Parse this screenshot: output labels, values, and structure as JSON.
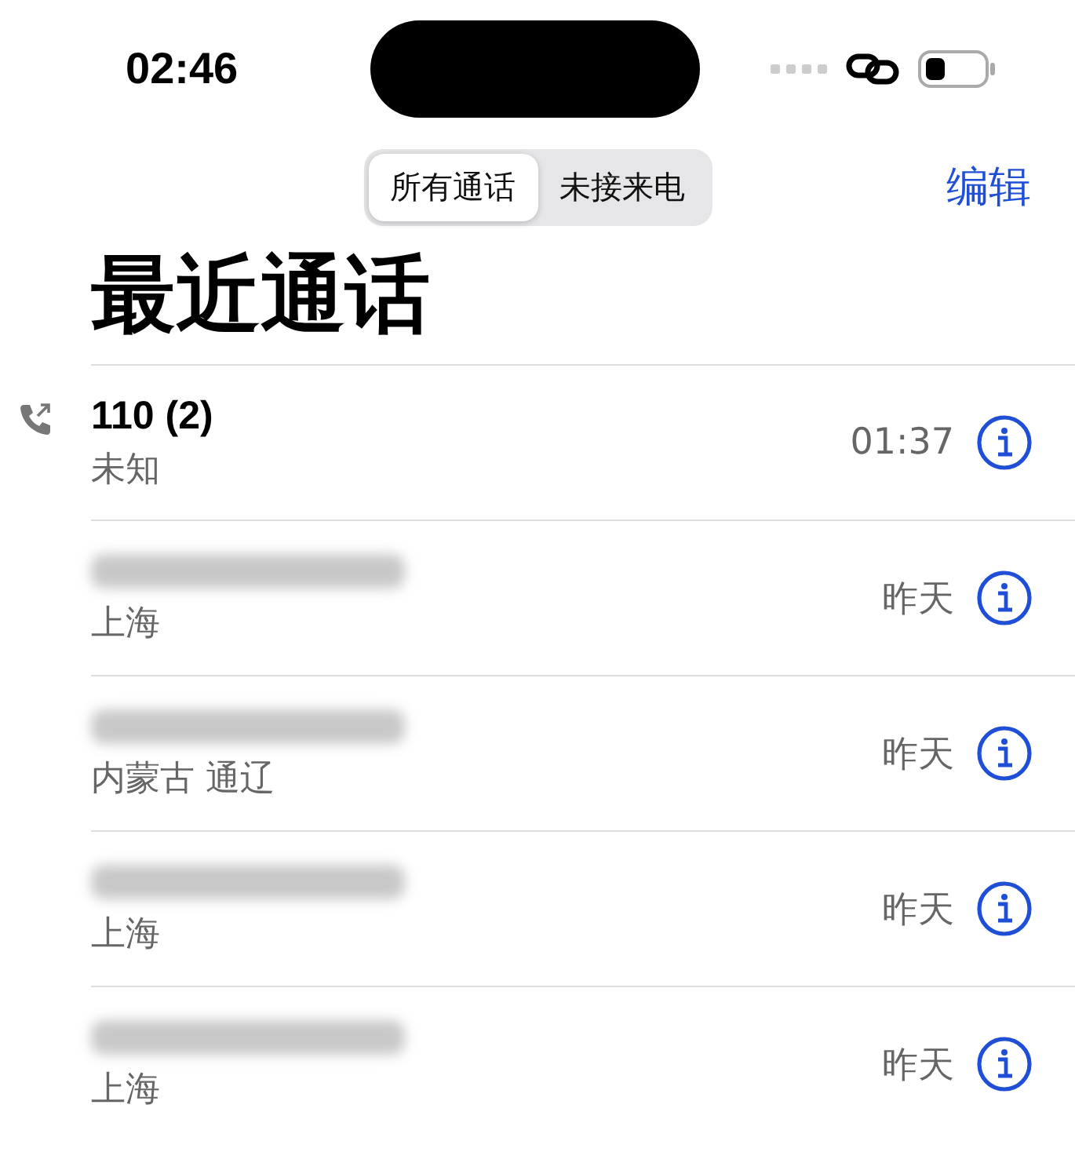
{
  "status_bar": {
    "time": "02:46"
  },
  "segments": [
    {
      "label": "所有通话",
      "selected": true
    },
    {
      "label": "未接来电",
      "selected": false
    }
  ],
  "edit_button": "编辑",
  "title": "最近通话",
  "calls": [
    {
      "kind": "number",
      "number": "110 (2)",
      "location": "未知",
      "time": "01:37",
      "outgoing": true
    },
    {
      "kind": "redacted",
      "location": "上海",
      "time": "昨天",
      "outgoing": false
    },
    {
      "kind": "redacted",
      "location": "内蒙古 通辽",
      "time": "昨天",
      "outgoing": false
    },
    {
      "kind": "redacted",
      "location": "上海",
      "time": "昨天",
      "outgoing": false
    },
    {
      "kind": "redacted",
      "location": "上海",
      "time": "昨天",
      "outgoing": false
    }
  ]
}
